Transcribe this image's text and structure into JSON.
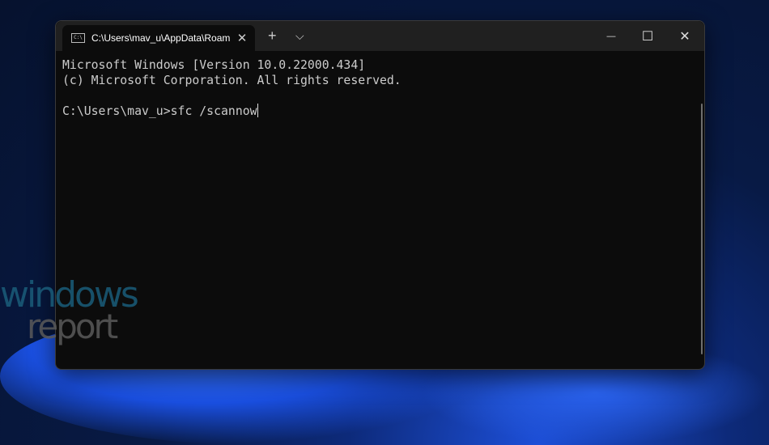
{
  "window": {
    "tab_title": "C:\\Users\\mav_u\\AppData\\Roam",
    "tab_icon": "cmd-icon",
    "new_tab": "+",
    "dropdown": "⌵",
    "minimize": "—",
    "maximize": "☐",
    "close": "✕",
    "tab_close": "✕"
  },
  "terminal": {
    "lines": [
      "Microsoft Windows [Version 10.0.22000.434]",
      "(c) Microsoft Corporation. All rights reserved.",
      ""
    ],
    "prompt": "C:\\Users\\mav_u>",
    "command": "sfc /scannow"
  },
  "watermark": {
    "line1": "windows",
    "line2": "report"
  }
}
